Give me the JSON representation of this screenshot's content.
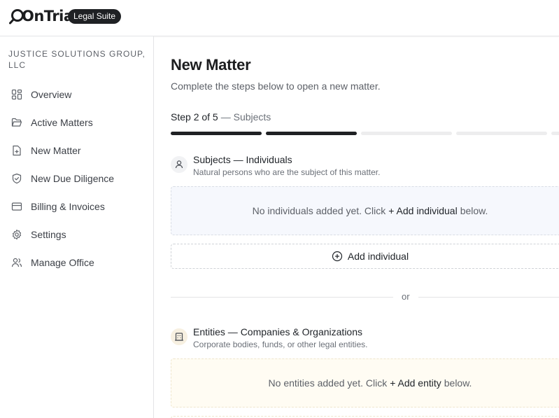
{
  "header": {
    "logo_text": "OnTrial",
    "badge": "Legal Suite"
  },
  "sidebar": {
    "org_name": "JUSTICE SOLUTIONS GROUP, LLC",
    "items": [
      {
        "label": "Overview",
        "icon": "grid-icon"
      },
      {
        "label": "Active Matters",
        "icon": "folder-open-icon"
      },
      {
        "label": "New Matter",
        "icon": "file-plus-icon"
      },
      {
        "label": "New Due Diligence",
        "icon": "shield-check-icon"
      },
      {
        "label": "Billing & Invoices",
        "icon": "credit-card-icon"
      },
      {
        "label": "Settings",
        "icon": "gear-icon"
      },
      {
        "label": "Manage Office",
        "icon": "users-icon"
      }
    ]
  },
  "main": {
    "title": "New Matter",
    "subtitle": "Complete the steps below to open a new matter.",
    "step": {
      "current_text": "Step 2 of 5",
      "name": "— Subjects",
      "current": 2,
      "total": 5
    },
    "individuals": {
      "title": "Subjects — Individuals",
      "description": "Natural persons who are the subject of this matter.",
      "empty_prefix": "No individuals added yet. Click",
      "empty_link": "+ Add individual",
      "empty_suffix": "below.",
      "add_label": "Add individual",
      "icon": "person-icon"
    },
    "divider_text": "or",
    "entities": {
      "title": "Entities — Companies & Organizations",
      "description": "Corporate bodies, funds, or other legal entities.",
      "empty_prefix": "No entities added yet. Click",
      "empty_link": "+ Add entity",
      "empty_suffix": "below.",
      "icon": "building-icon"
    }
  },
  "colors": {
    "progress_done": "#1f2124",
    "progress_todo": "#ededee",
    "individuals_bg": "#f6f8fd",
    "entities_bg": "#fffcf3"
  }
}
